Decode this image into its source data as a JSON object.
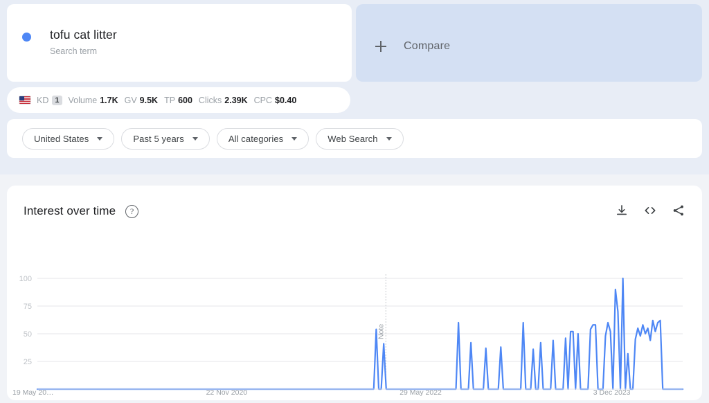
{
  "term_card": {
    "title": "tofu cat litter",
    "subtitle": "Search term",
    "dot_color": "#4e87f5"
  },
  "compare_card": {
    "label": "Compare",
    "icon": "plus-icon",
    "bg_color": "#d4e0f3"
  },
  "metrics": {
    "flag": "us-flag-icon",
    "items": [
      {
        "label": "KD",
        "value": "1",
        "badge": true
      },
      {
        "label": "Volume",
        "value": "1.7K"
      },
      {
        "label": "GV",
        "value": "9.5K"
      },
      {
        "label": "TP",
        "value": "600"
      },
      {
        "label": "Clicks",
        "value": "2.39K"
      },
      {
        "label": "CPC",
        "value": "$0.40"
      }
    ]
  },
  "filters": [
    {
      "name": "location",
      "label": "United States"
    },
    {
      "name": "time-range",
      "label": "Past 5 years"
    },
    {
      "name": "category",
      "label": "All categories"
    },
    {
      "name": "search-type",
      "label": "Web Search"
    }
  ],
  "chart_panel": {
    "title": "Interest over time",
    "help": "?",
    "actions": [
      {
        "name": "download-icon",
        "title": "Download CSV"
      },
      {
        "name": "embed-code-icon",
        "title": "Embed"
      },
      {
        "name": "share-icon",
        "title": "Share"
      }
    ]
  },
  "chart_data": {
    "type": "line",
    "title": "Interest over time",
    "xlabel": "",
    "ylabel": "",
    "ylim": [
      0,
      100
    ],
    "grid": true,
    "legend": null,
    "line_color": "#4e87f5",
    "y_ticks": [
      100,
      75,
      50,
      25
    ],
    "x_ticks": [
      "19 May 20…",
      "22 Nov 2020",
      "29 May 2022",
      "3 Dec 2023"
    ],
    "x_tick_positions": [
      0.0,
      0.3,
      0.6,
      0.9
    ],
    "annotations": [
      {
        "name": "note-marker",
        "label": "Note",
        "x_fraction": 0.54
      }
    ],
    "series": [
      {
        "name": "tofu cat litter",
        "values": [
          0,
          0,
          0,
          0,
          0,
          0,
          0,
          0,
          0,
          0,
          0,
          0,
          0,
          0,
          0,
          0,
          0,
          0,
          0,
          0,
          0,
          0,
          0,
          0,
          0,
          0,
          0,
          0,
          0,
          0,
          0,
          0,
          0,
          0,
          0,
          0,
          0,
          0,
          0,
          0,
          0,
          0,
          0,
          0,
          0,
          0,
          0,
          0,
          0,
          0,
          0,
          0,
          0,
          0,
          0,
          0,
          0,
          0,
          0,
          0,
          0,
          0,
          0,
          0,
          0,
          0,
          0,
          0,
          0,
          0,
          0,
          0,
          0,
          0,
          0,
          0,
          0,
          0,
          0,
          0,
          0,
          0,
          0,
          0,
          0,
          0,
          0,
          0,
          0,
          0,
          0,
          0,
          0,
          0,
          0,
          0,
          0,
          0,
          0,
          0,
          0,
          0,
          0,
          0,
          0,
          0,
          0,
          0,
          0,
          0,
          0,
          0,
          0,
          0,
          0,
          0,
          0,
          0,
          0,
          0,
          0,
          0,
          0,
          0,
          0,
          0,
          0,
          0,
          0,
          0,
          0,
          0,
          0,
          0,
          0,
          0,
          54,
          0,
          0,
          41,
          0,
          0,
          0,
          0,
          0,
          0,
          0,
          0,
          0,
          0,
          0,
          0,
          0,
          0,
          0,
          0,
          0,
          0,
          0,
          0,
          0,
          0,
          0,
          0,
          0,
          0,
          0,
          0,
          0,
          60,
          0,
          0,
          0,
          0,
          42,
          0,
          0,
          0,
          0,
          0,
          37,
          0,
          0,
          0,
          0,
          0,
          38,
          0,
          0,
          0,
          0,
          0,
          0,
          0,
          0,
          60,
          0,
          0,
          0,
          36,
          0,
          0,
          42,
          0,
          0,
          0,
          0,
          44,
          0,
          0,
          0,
          0,
          46,
          0,
          52,
          52,
          0,
          50,
          0,
          0,
          0,
          0,
          54,
          58,
          58,
          0,
          0,
          0,
          48,
          60,
          52,
          0,
          90,
          70,
          0,
          100,
          0,
          32,
          0,
          0,
          45,
          55,
          48,
          58,
          50,
          55,
          44,
          62,
          52,
          60,
          62,
          0,
          0,
          0,
          0,
          0,
          0,
          0,
          0,
          0
        ]
      }
    ]
  }
}
